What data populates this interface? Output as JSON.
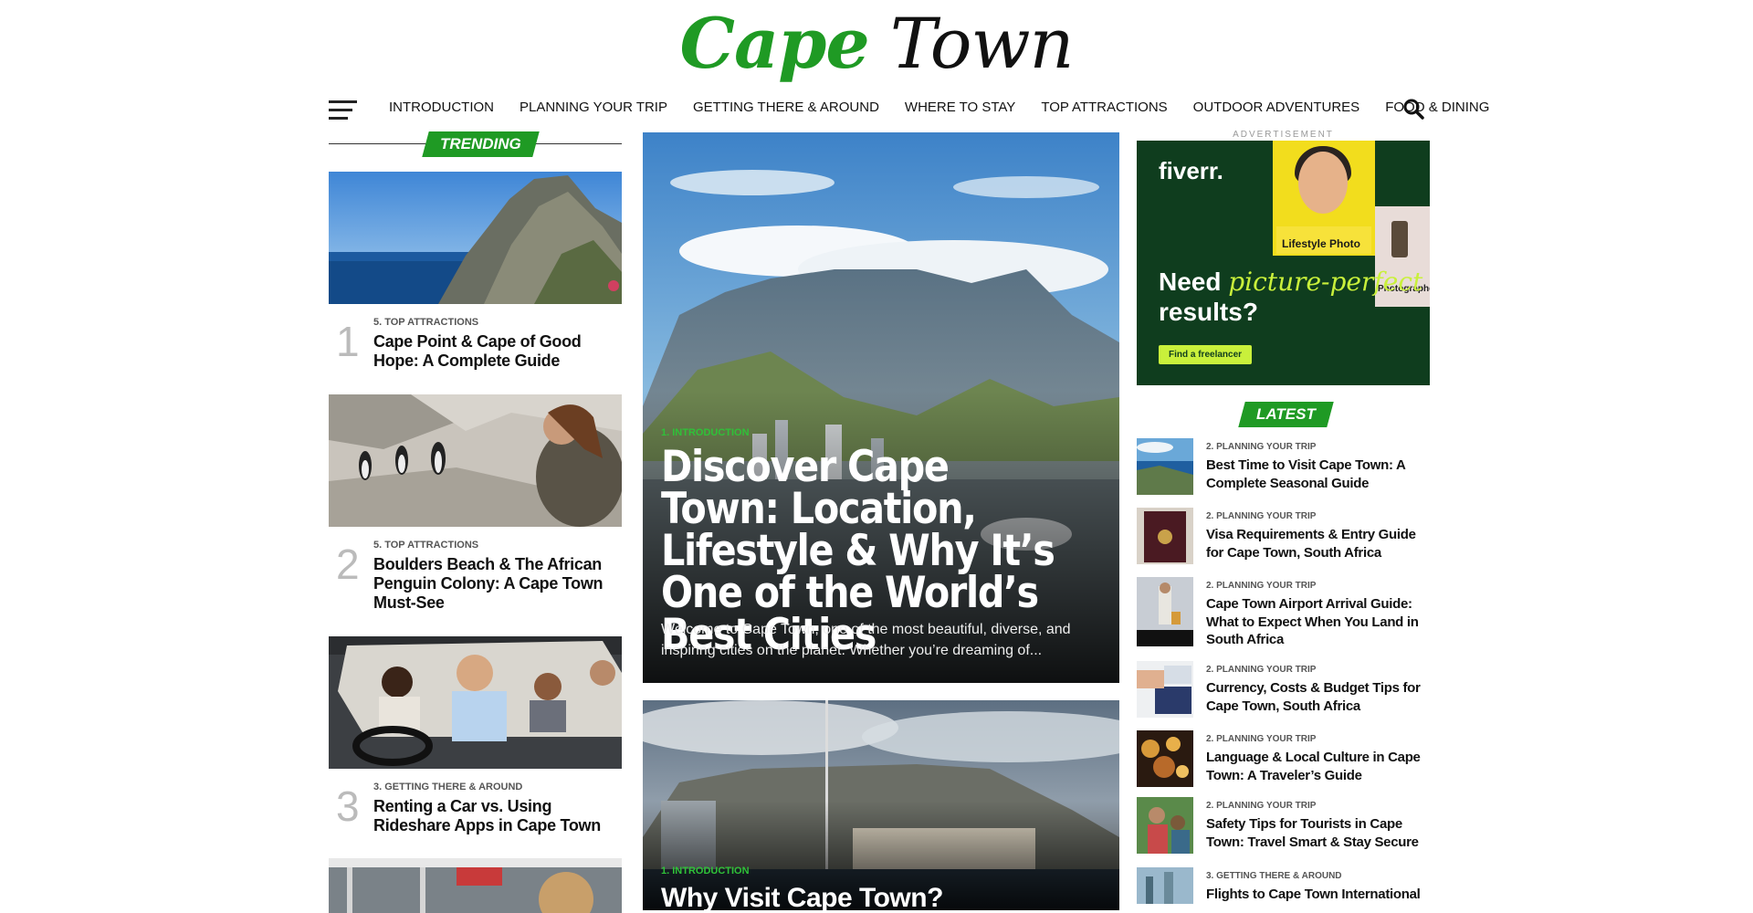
{
  "logo": {
    "word1": "Cape",
    "word2": "Town"
  },
  "nav": {
    "items": [
      "INTRODUCTION",
      "PLANNING YOUR TRIP",
      "GETTING THERE & AROUND",
      "WHERE TO STAY",
      "TOP ATTRACTIONS",
      "OUTDOOR ADVENTURES",
      "FOOD & DINING"
    ]
  },
  "trending": {
    "label": "TRENDING",
    "items": [
      {
        "num": "1",
        "category": "5. TOP ATTRACTIONS",
        "title": "Cape Point & Cape of Good Hope: A Complete Guide"
      },
      {
        "num": "2",
        "category": "5. TOP ATTRACTIONS",
        "title": "Boulders Beach & The African Penguin Colony: A Cape Town Must-See"
      },
      {
        "num": "3",
        "category": "3. GETTING THERE & AROUND",
        "title": "Renting a Car vs. Using Rideshare Apps in Cape Town"
      }
    ]
  },
  "featured": [
    {
      "category": "1. INTRODUCTION",
      "title": "Discover Cape Town: Location, Lifestyle & Why It’s One of the World’s Best Cities",
      "excerpt": "Welcome to Cape Town, one of the most beautiful, diverse, and inspiring cities on the planet. Whether you’re dreaming of..."
    },
    {
      "category": "1. INTRODUCTION",
      "title": "Why Visit Cape Town?"
    }
  ],
  "ad": {
    "label": "ADVERTISEMENT",
    "brand": "fiverr.",
    "chip": "Lifestyle Photo",
    "card_label": "Photographer",
    "line1": "Need ",
    "accent": "picture-perfect",
    "line2": " results?",
    "button": "Find a freelancer"
  },
  "latest": {
    "label": "LATEST",
    "items": [
      {
        "category": "2. PLANNING YOUR TRIP",
        "title": "Best Time to Visit Cape Town: A Complete Seasonal Guide"
      },
      {
        "category": "2. PLANNING YOUR TRIP",
        "title": "Visa Requirements & Entry Guide for Cape Town, South Africa"
      },
      {
        "category": "2. PLANNING YOUR TRIP",
        "title": "Cape Town Airport Arrival Guide: What to Expect When You Land in South Africa"
      },
      {
        "category": "2. PLANNING YOUR TRIP",
        "title": "Currency, Costs & Budget Tips for Cape Town, South Africa"
      },
      {
        "category": "2. PLANNING YOUR TRIP",
        "title": "Language & Local Culture in Cape Town: A Traveler’s Guide"
      },
      {
        "category": "2. PLANNING YOUR TRIP",
        "title": "Safety Tips for Tourists in Cape Town: Travel Smart & Stay Secure"
      },
      {
        "category": "3. GETTING THERE & AROUND",
        "title": "Flights to Cape Town International"
      }
    ]
  },
  "colors": {
    "accent": "#1f9a24",
    "category_green": "#2fc138",
    "ad_bg": "#0f3d1e",
    "ad_accent": "#c9f03b"
  }
}
